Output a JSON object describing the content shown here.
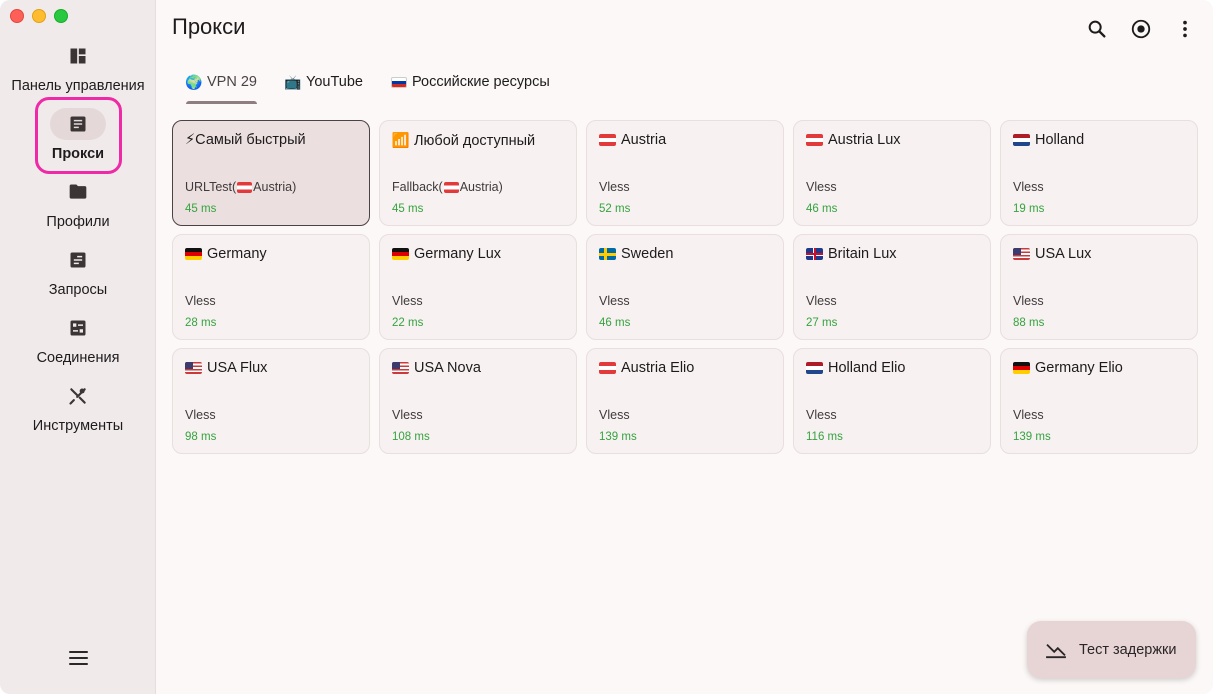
{
  "sidebar": {
    "items": [
      {
        "label": "Панель управления",
        "icon": "dashboard-icon"
      },
      {
        "label": "Прокси",
        "icon": "proxy-list-icon"
      },
      {
        "label": "Профили",
        "icon": "folder-icon"
      },
      {
        "label": "Запросы",
        "icon": "requests-icon"
      },
      {
        "label": "Соединения",
        "icon": "connections-icon"
      },
      {
        "label": "Инструменты",
        "icon": "tools-icon"
      }
    ],
    "active_index": 1
  },
  "header": {
    "title": "Прокси",
    "actions": [
      "search-icon",
      "target-icon",
      "more-vert-icon"
    ]
  },
  "tabs": [
    {
      "emoji": "🌍",
      "label": "VPN 29",
      "active": true
    },
    {
      "emoji": "📺",
      "label": "YouTube",
      "active": false
    },
    {
      "emoji": "ru-flag",
      "label": "Российские ресурсы",
      "active": false
    }
  ],
  "proxies": [
    {
      "title": "⚡Самый быстрый",
      "type_prefix": "URLTest(",
      "type_flag": "at",
      "type_suffix": "Austria)",
      "delay": "45 ms",
      "selected": true
    },
    {
      "title": "Любой доступный",
      "icon": "📶",
      "type_prefix": "Fallback(",
      "type_flag": "at",
      "type_suffix": "Austria)",
      "delay": "45 ms"
    },
    {
      "flag": "at",
      "title": "Austria",
      "type": "Vless",
      "delay": "52 ms"
    },
    {
      "flag": "at",
      "title": "Austria Lux",
      "type": "Vless",
      "delay": "46 ms"
    },
    {
      "flag": "nl",
      "title": "Holland",
      "type": "Vless",
      "delay": "19 ms"
    },
    {
      "flag": "de",
      "title": "Germany",
      "type": "Vless",
      "delay": "28 ms"
    },
    {
      "flag": "de",
      "title": "Germany Lux",
      "type": "Vless",
      "delay": "22 ms"
    },
    {
      "flag": "se",
      "title": "Sweden",
      "type": "Vless",
      "delay": "46 ms"
    },
    {
      "flag": "gb",
      "title": "Britain Lux",
      "type": "Vless",
      "delay": "27 ms"
    },
    {
      "flag": "us",
      "title": "USA Lux",
      "type": "Vless",
      "delay": "88 ms"
    },
    {
      "flag": "us",
      "title": "USA Flux",
      "type": "Vless",
      "delay": "98 ms"
    },
    {
      "flag": "us",
      "title": "USA Nova",
      "type": "Vless",
      "delay": "108 ms"
    },
    {
      "flag": "at",
      "title": "Austria Elio",
      "type": "Vless",
      "delay": "139 ms"
    },
    {
      "flag": "nl",
      "title": "Holland Elio",
      "type": "Vless",
      "delay": "116 ms"
    },
    {
      "flag": "de",
      "title": "Germany Elio",
      "type": "Vless",
      "delay": "139 ms"
    }
  ],
  "fab": {
    "label": "Тест задержки",
    "icon": "speed-test-icon"
  },
  "colors": {
    "accent_highlight": "#ee2aa6",
    "delay_green": "#35a33f"
  }
}
